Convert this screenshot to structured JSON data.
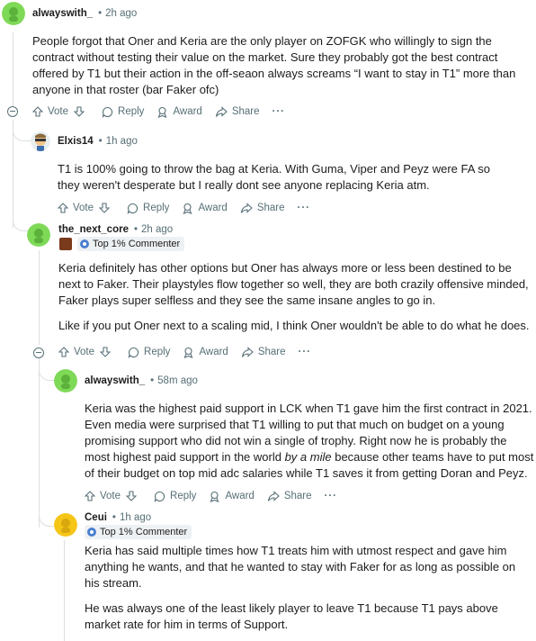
{
  "comments": [
    {
      "user": "alwayswith_",
      "time": "2h ago",
      "paragraphs": [
        "People forgot that Oner and Keria are the only player on ZOFGK who willingly to sign the contract without testing their value on the market. Sure they probably got the best contract offered by T1 but their action in the off-seaon always screams “I want to stay in T1” more than anyone in that roster (bar Faker ofc)"
      ]
    },
    {
      "user": "Elxis14",
      "time": "1h ago",
      "paragraphs": [
        "T1 is 100% going to throw the bag at Keria. With Guma, Viper and Peyz were FA so they weren't desperate but I really dont see anyone replacing Keria atm."
      ]
    },
    {
      "user": "the_next_core",
      "time": "2h ago",
      "badge": "Top 1% Commenter",
      "paragraphs": [
        "Keria definitely has other options but Oner has always more or less been destined to be next to Faker. Their playstyles flow together so well, they are both crazily offensive minded, Faker plays super selfless and they see the same insane angles to go in.",
        "Like if you put Oner next to a scaling mid, I think Oner wouldn't be able to do what he does."
      ]
    },
    {
      "user": "alwayswith_",
      "time": "58m ago",
      "paragraph_before": "Keria was the highest paid support in LCK when T1 gave him the first contract in 2021. Even media were surprised that T1 willing to put that much on budget on a young promising support who did not win a single of trophy. Right now he is probably the most highest paid support in the world ",
      "paragraph_em": "by a mile",
      "paragraph_after": " because other teams have to put most of their budget on top mid adc salaries while T1 saves it from getting Doran and Peyz."
    },
    {
      "user": "Ceui",
      "time": "1h ago",
      "badge": "Top 1% Commenter",
      "paragraphs": [
        "Keria has said multiple times how T1 treats him with utmost respect and gave him anything he wants, and that he wanted to stay with Faker for as long as possible on his stream.",
        "He was always one of the least likely player to leave T1 because T1 pays above market rate for him in terms of Support."
      ]
    }
  ],
  "actions": {
    "vote": "Vote",
    "reply": "Reply",
    "award": "Award",
    "share": "Share",
    "more": "···"
  },
  "dot": "•",
  "icons": [
    "arrow-up-icon",
    "arrow-down-icon",
    "reply-bubble-icon",
    "award-ribbon-icon",
    "share-arrow-icon",
    "more-icon",
    "collapse-icon",
    "avatar-icon"
  ],
  "colors": {
    "avatar_green": "#7ed957",
    "avatar_yellow": "#f5c518",
    "meta_gray": "#576f76",
    "thread_line": "#dcdfe1",
    "badge_blue": "#4a7fd0"
  }
}
